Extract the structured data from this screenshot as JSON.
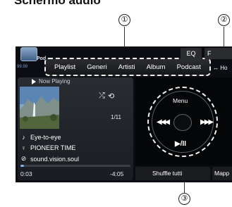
{
  "page_title": "Schermo audio",
  "callouts": [
    "①",
    "②",
    "③"
  ],
  "app": {
    "name": "Pod",
    "sub": "99.99"
  },
  "tabs": [
    "Playlist",
    "Generi",
    "Artisti",
    "Album",
    "Podcast"
  ],
  "top_buttons": {
    "eq": "EQ",
    "f": "F",
    "ho": "↔ Ho"
  },
  "now_playing": {
    "label": "Now Playing",
    "track_number": "1/11",
    "song": "Eye-to-eye",
    "artist": "PIONEER TIME",
    "album": "sound.vision.soul",
    "elapsed": "0:03",
    "remaining": "-4:05",
    "progress": 0.03
  },
  "controls": {
    "menu": "Menu",
    "prev": "◀◀◀",
    "next": "▶▶▶",
    "play_pause": "▶/II"
  },
  "bottom_buttons": {
    "shuffle_all": "Shuffle tutti",
    "map": "Mapp"
  },
  "icons": {
    "shuffle": "⤮",
    "repeat": "⟲",
    "song": "♪",
    "artist": "♀",
    "album": "⊘"
  }
}
